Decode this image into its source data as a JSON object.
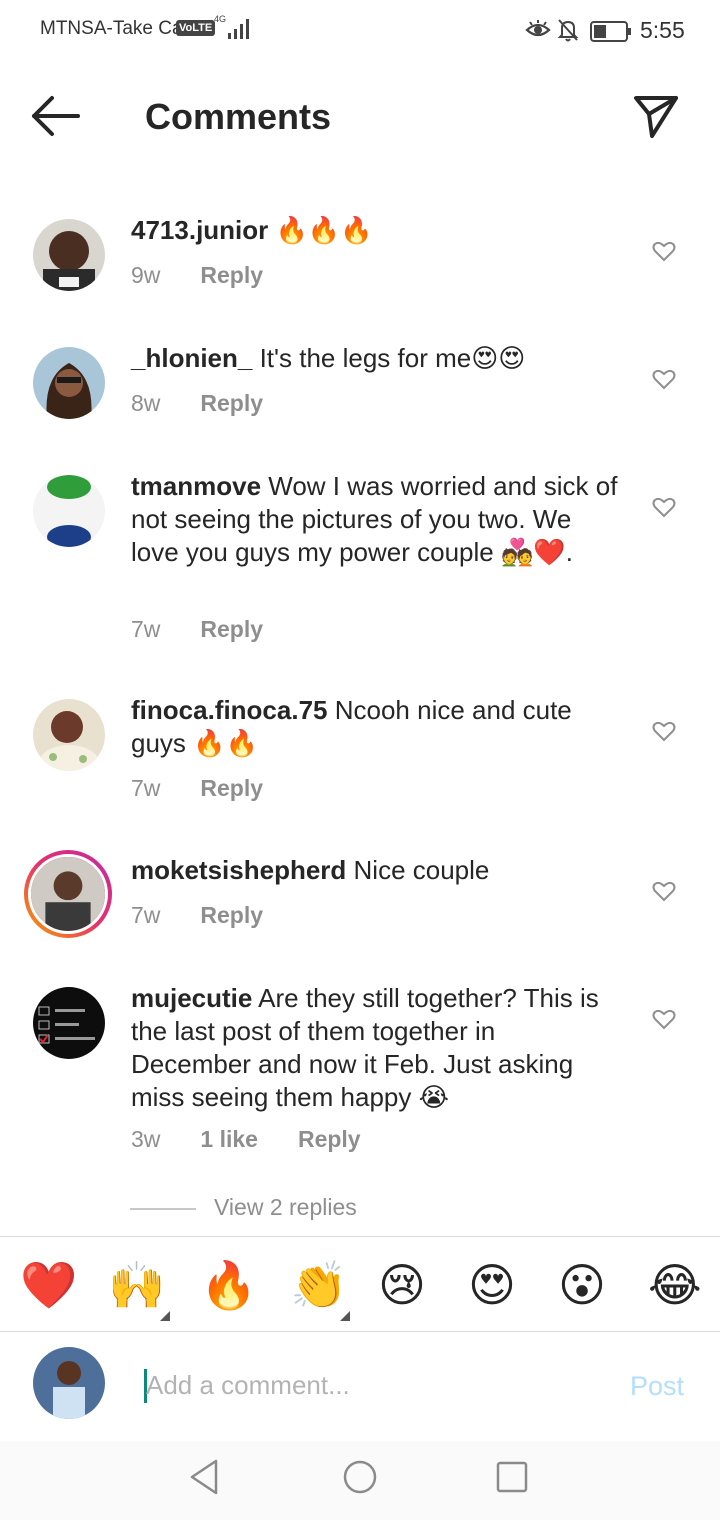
{
  "status_bar": {
    "carrier": "MTNSA-Take Ca",
    "volte": "VoLTE",
    "network": "4G",
    "time": "5:55"
  },
  "header": {
    "title": "Comments"
  },
  "comments": [
    {
      "username": "4713.junior",
      "text": " 🔥🔥🔥",
      "time": "9w",
      "likes": "",
      "reply": "Reply"
    },
    {
      "username": "_hlonien_",
      "text": " It's the legs for me😍😍",
      "time": "8w",
      "likes": "",
      "reply": "Reply"
    },
    {
      "username": "tmanmove",
      "text": " Wow I was worried and sick of not seeing the pictures of you two. We love you guys my power couple 💑❤️.",
      "time": "7w",
      "likes": "",
      "reply": "Reply"
    },
    {
      "username": "finoca.finoca.75",
      "text": " Ncooh nice and cute guys 🔥🔥",
      "time": "7w",
      "likes": "",
      "reply": "Reply"
    },
    {
      "username": "moketsishepherd",
      "text": " Nice couple",
      "time": "7w",
      "likes": "",
      "reply": "Reply"
    },
    {
      "username": "mujecutie",
      "text": " Are they still together? This is the last post of them together in December and now it Feb. Just asking miss seeing them happy 😭",
      "time": "3w",
      "likes": "1 like",
      "reply": "Reply"
    }
  ],
  "view_replies": "View 2 replies",
  "emoji_bar": [
    "❤️",
    "🙌",
    "🔥",
    "👏",
    "😢",
    "😍",
    "😮",
    "😂"
  ],
  "input": {
    "placeholder": "Add a comment...",
    "post_label": "Post"
  },
  "colors": {
    "text": "#262626",
    "meta": "#8e8e8e",
    "post_disabled": "#b2dffc",
    "story_ring": "#e6306b"
  }
}
